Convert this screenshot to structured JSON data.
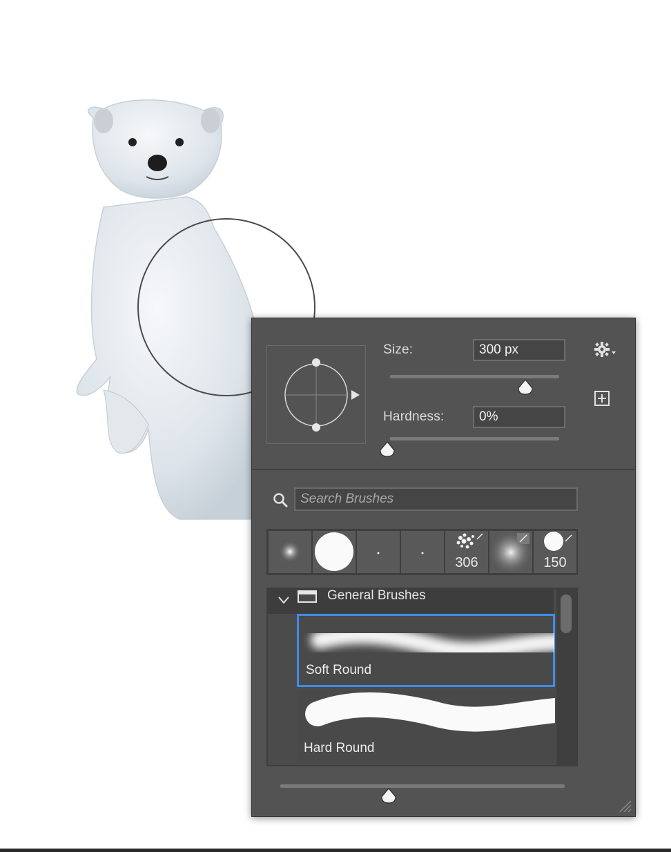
{
  "brush_panel": {
    "size_label": "Size:",
    "size_value": "300 px",
    "size_slider_level": 0.8,
    "hardness_label": "Hardness:",
    "hardness_value": "0%",
    "hardness_slider_level": 0.0,
    "settings_icon": "gear-icon",
    "new_preset_icon": "plus-square-icon"
  },
  "search": {
    "placeholder": "Search Brushes"
  },
  "recent_presets": [
    {
      "name": "soft-small",
      "count": ""
    },
    {
      "name": "hard-large",
      "count": ""
    },
    {
      "name": "dot-1",
      "count": ""
    },
    {
      "name": "dot-2",
      "count": ""
    },
    {
      "name": "spatter",
      "count": "306"
    },
    {
      "name": "soft-airbrush",
      "count": ""
    },
    {
      "name": "hard-round",
      "count": "150"
    }
  ],
  "brush_list": {
    "group_label": "General Brushes",
    "items": [
      {
        "label": "Soft Round",
        "selected": true
      },
      {
        "label": "Hard Round",
        "selected": false
      }
    ]
  },
  "preview_zoom_level": 0.38,
  "colors": {
    "panel_bg": "#535353",
    "selection_accent": "#3d8ee8"
  }
}
